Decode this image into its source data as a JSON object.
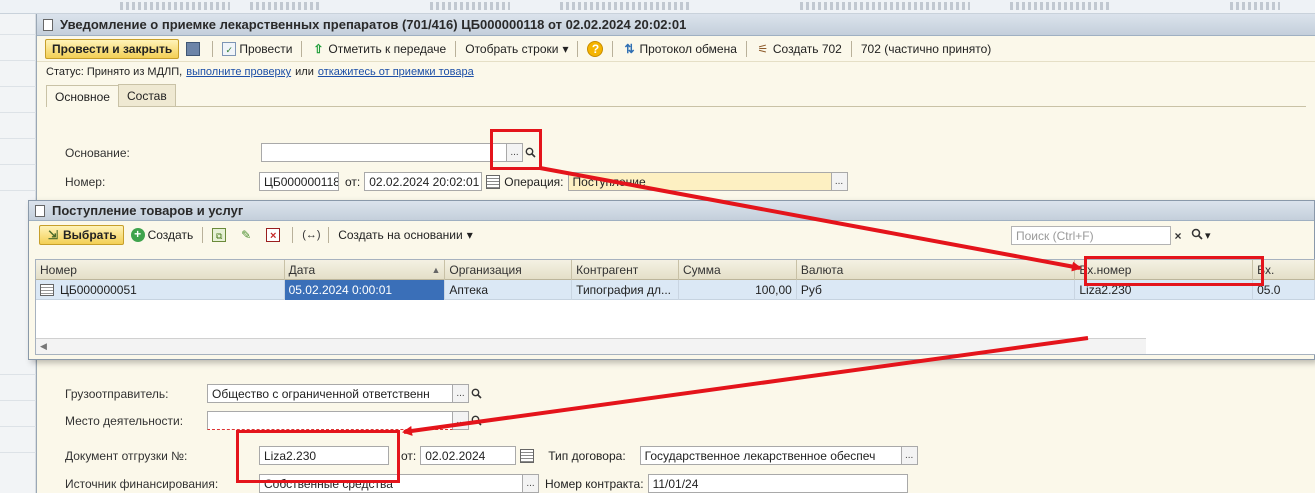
{
  "main_window": {
    "title": "Уведомление о приемке лекарственных препаратов (701/416) ЦБ000000118 от 02.02.2024 20:02:01",
    "toolbar": {
      "post_close": "Провести и закрыть",
      "post": "Провести",
      "mark_transfer": "Отметить к передаче",
      "select_rows": "Отобрать строки",
      "exchange_protocol": "Протокол обмена",
      "create_702": "Создать 702",
      "status_702": "702 (частично принято)"
    },
    "status": {
      "prefix": "Статус: Принято из МДЛП,",
      "link_check": "выполните проверку",
      "or": "или",
      "link_refuse": "откажитесь от приемки товара"
    },
    "tabs": [
      "Основное",
      "Состав"
    ],
    "fields": {
      "basis_label": "Основание:",
      "basis_value": "",
      "number_label": "Номер:",
      "number_value": "ЦБ000000118",
      "from_label": "от:",
      "date_value": "02.02.2024 20:02:01",
      "operation_label": "Операция:",
      "operation_value": "Поступление",
      "shipper_label": "Грузоотправитель:",
      "shipper_value": "Общество с ограниченной ответственн",
      "activity_place_label": "Место деятельности:",
      "activity_place_value": "",
      "ship_doc_label": "Документ отгрузки №:",
      "ship_doc_value": "Liza2.230",
      "ship_doc_from_label": "от:",
      "ship_doc_date": "02.02.2024",
      "contract_type_label": "Тип договора:",
      "contract_type_value": "Государственное лекарственное обеспеч",
      "funding_label": "Источник финансирования:",
      "funding_value": "Собственные средства",
      "contract_number_label": "Номер контракта:",
      "contract_number_value": "11/01/24"
    }
  },
  "dialog": {
    "title": "Поступление товаров и услуг",
    "toolbar": {
      "select": "Выбрать",
      "create": "Создать",
      "create_based_on": "Создать на основании"
    },
    "search_placeholder": "Поиск (Ctrl+F)",
    "columns": [
      "Номер",
      "Дата",
      "Организация",
      "Контрагент",
      "Сумма",
      "Валюта",
      "Вх.номер",
      "Вх."
    ],
    "rows": [
      {
        "number": "ЦБ000000051",
        "date": "05.02.2024 0:00:01",
        "org": "Аптека",
        "counterparty": "Типография дл...",
        "sum": "100,00",
        "currency": "Руб",
        "in_number": "Liza2.230",
        "in_date": "05.0"
      }
    ]
  },
  "icons": {
    "ellipsis": "...",
    "search": "🔍",
    "dropdown": "▾",
    "help": "?",
    "close": "×"
  },
  "colors": {
    "accent_red": "#e4141b",
    "button_yellow": "#f3cf55",
    "selected_cell": "#3a6fb8"
  }
}
